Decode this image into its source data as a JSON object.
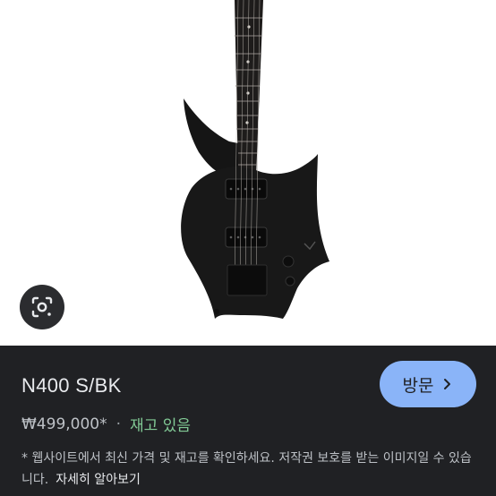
{
  "product": {
    "title": "N400 S/BK",
    "price": "₩499,000*",
    "separator": "·",
    "stock_status": "재고 있음",
    "notice": "* 웹사이트에서 최신 가격 및 재고를 확인하세요. 저작권 보호를 받는 이미지일 수 있습니다.",
    "learn_more": "자세히 알아보기"
  },
  "actions": {
    "visit_label": "방문",
    "visit_icon": "chevron-right-icon",
    "lens_icon": "google-lens-icon"
  },
  "colors": {
    "panel_bg": "#202124",
    "visit_button_bg": "#8ab4f8",
    "stock_green": "#81c995"
  }
}
